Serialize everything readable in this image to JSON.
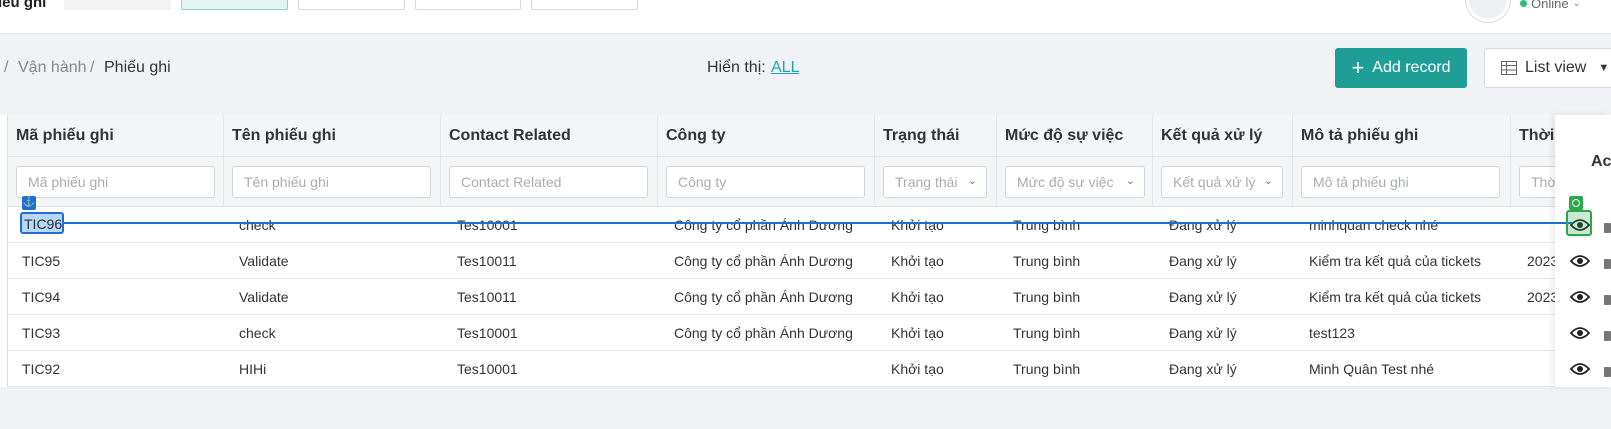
{
  "header": {
    "app_title": "iếu ghi",
    "status": "Online",
    "status_color": "#27c46b",
    "tabs": [
      "",
      "",
      "",
      "",
      ""
    ]
  },
  "breadcrumb": {
    "separator": "/",
    "items": [
      "Vận hành",
      "Phiếu ghi"
    ]
  },
  "display": {
    "label": "Hiển thị:",
    "value": "ALL"
  },
  "toolbar": {
    "add_label": "Add record",
    "add_color": "#1f9e95",
    "view_label": "List view"
  },
  "table": {
    "columns": [
      "Mã phiếu ghi",
      "Tên phiếu ghi",
      "Contact Related",
      "Công ty",
      "Trạng thái",
      "Mức độ sự việc",
      "Kết quả xử lý",
      "Mô tả phiếu ghi",
      "Thời"
    ],
    "filters": [
      "Mã phiếu ghi",
      "Tên phiếu ghi",
      "Contact Related",
      "Công ty",
      "Trạng thái",
      "Mức độ sự việc",
      "Kết quả xử lý",
      "Mô tả phiếu ghi",
      "Thờ"
    ],
    "actions_header": "Ac",
    "rows": [
      {
        "code": "TIC96",
        "name": "check",
        "contact": "Tes10001",
        "company": "Công ty cổ phần Ánh Dương",
        "status": "Khởi tạo",
        "severity": "Trung bình",
        "result": "Đang xử lý",
        "desc": "minhquan check nhé",
        "time": ""
      },
      {
        "code": "TIC95",
        "name": "Validate",
        "contact": "Tes10011",
        "company": "Công ty cổ phần Ánh Dương",
        "status": "Khởi tạo",
        "severity": "Trung bình",
        "result": "Đang xử lý",
        "desc": "Kiểm tra kết quả của tickets",
        "time": "2023"
      },
      {
        "code": "TIC94",
        "name": "Validate",
        "contact": "Tes10011",
        "company": "Công ty cổ phần Ánh Dương",
        "status": "Khởi tạo",
        "severity": "Trung bình",
        "result": "Đang xử lý",
        "desc": "Kiểm tra kết quả của tickets",
        "time": "2023"
      },
      {
        "code": "TIC93",
        "name": "check",
        "contact": "Tes10001",
        "company": "Công ty cổ phần Ánh Dương",
        "status": "Khởi tạo",
        "severity": "Trung bình",
        "result": "Đang xử lý",
        "desc": " test123",
        "time": ""
      },
      {
        "code": "TIC92",
        "name": "HIHi",
        "contact": "Tes10001",
        "company": "",
        "status": "Khởi tạo",
        "severity": "Trung bình",
        "result": "Đang xử lý",
        "desc": "Minh Quân Test nhé",
        "time": ""
      }
    ]
  },
  "overlay": {
    "anchor_icon": "anchor-icon",
    "target_icon": "target-icon",
    "line_color": "#1f6fd1",
    "target_color": "#2aa84a"
  }
}
